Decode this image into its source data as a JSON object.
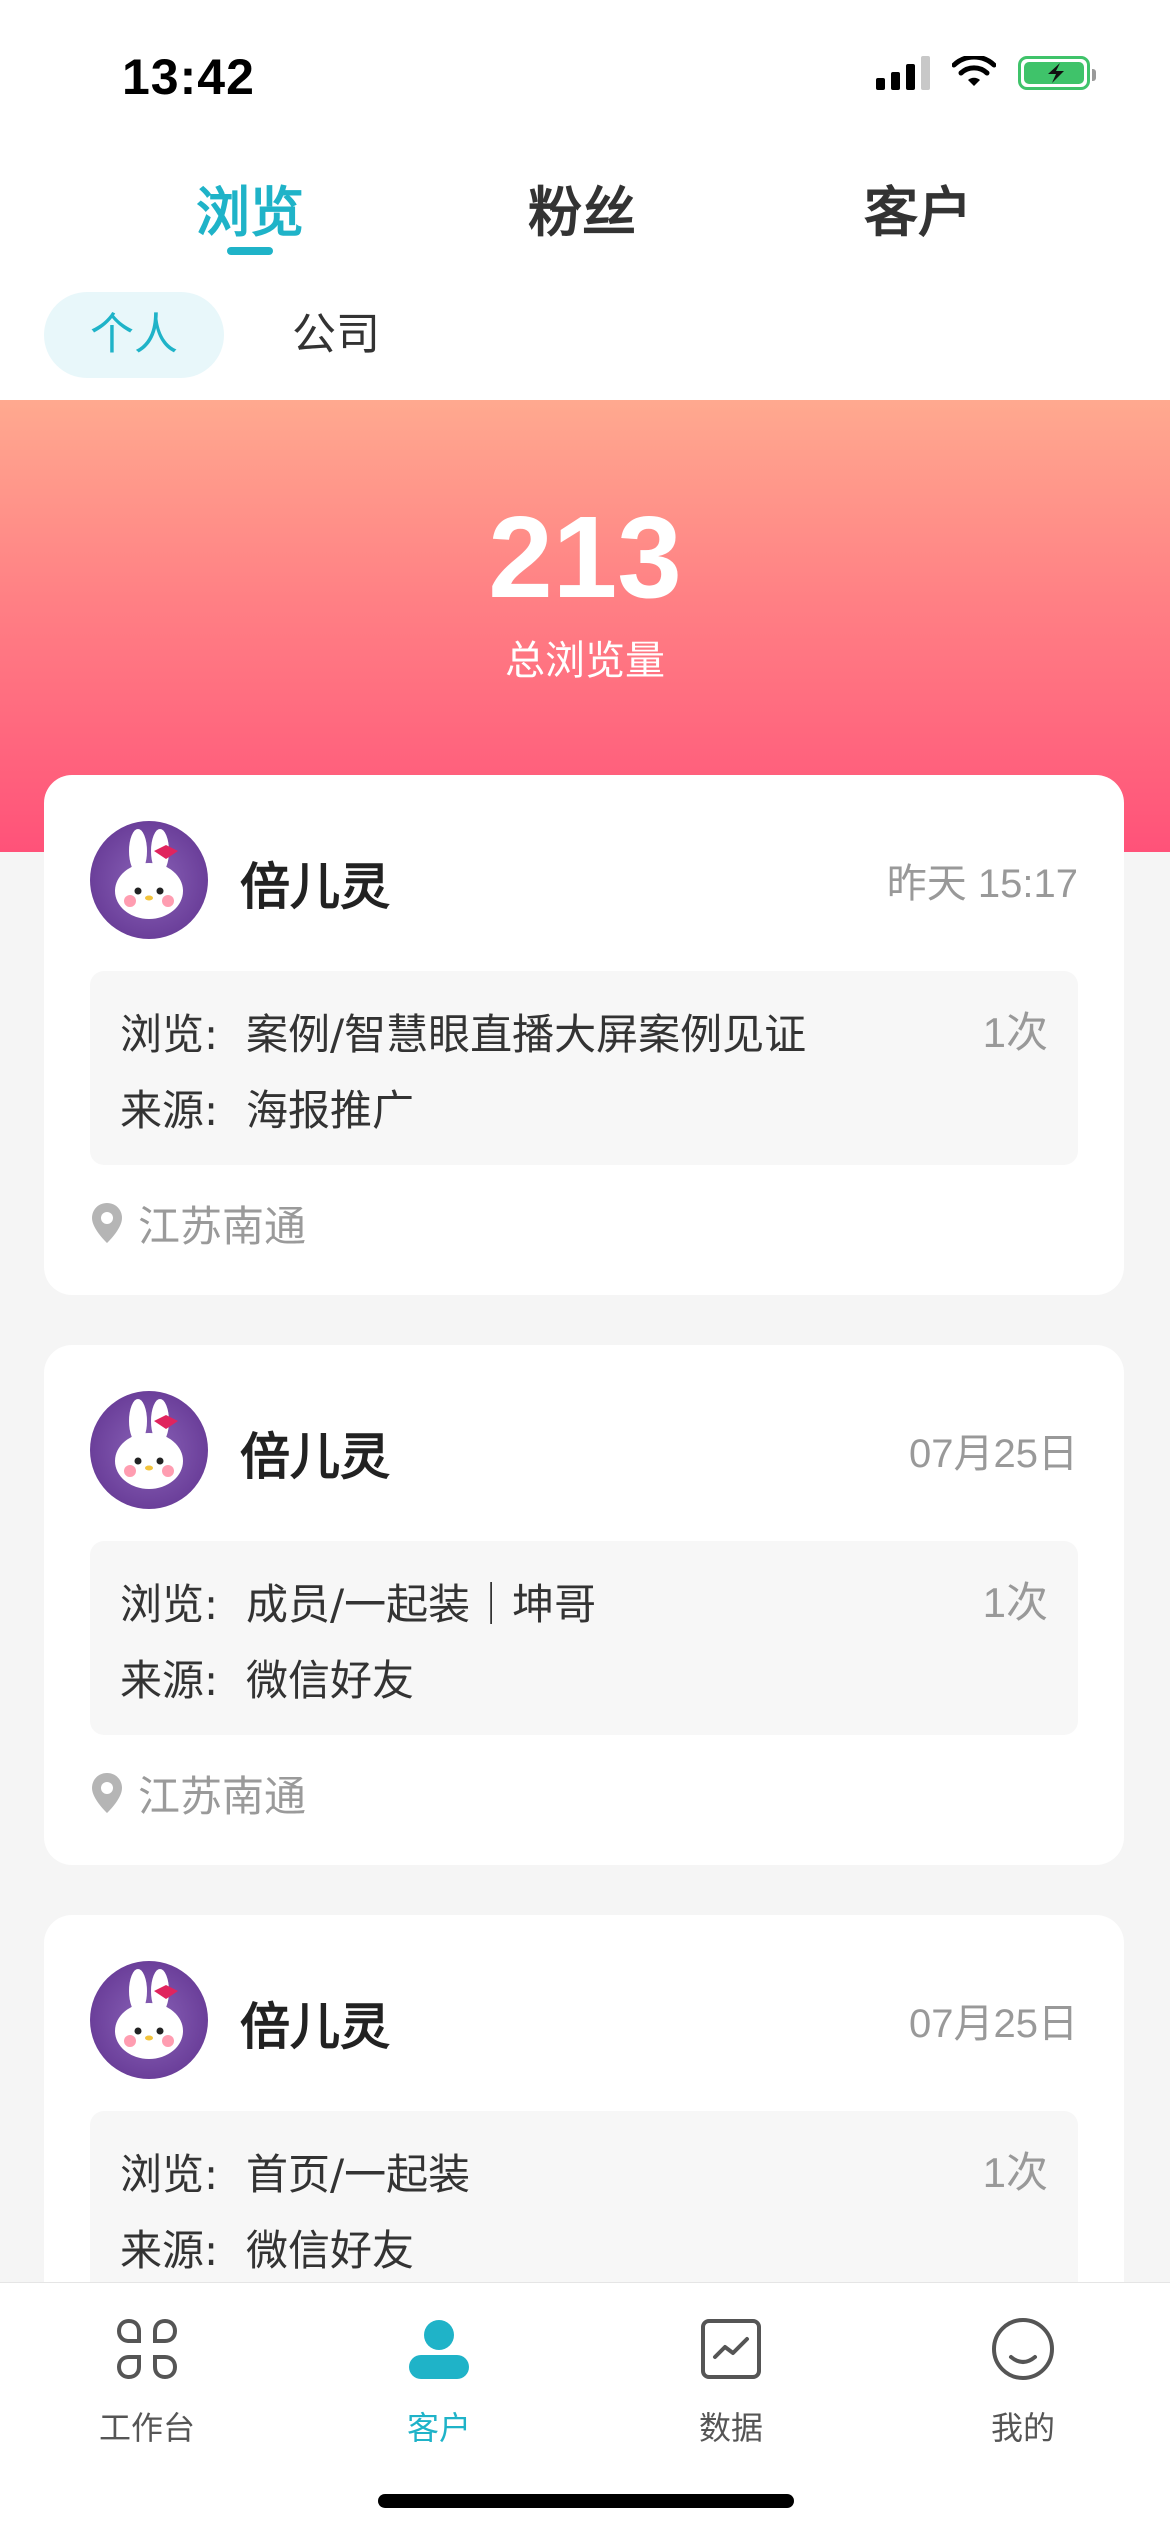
{
  "status_bar": {
    "time": "13:42"
  },
  "top_tabs": [
    {
      "label": "浏览",
      "active": true
    },
    {
      "label": "粉丝",
      "active": false
    },
    {
      "label": "客户",
      "active": false
    }
  ],
  "sub_tabs": [
    {
      "label": "个人",
      "active": true
    },
    {
      "label": "公司",
      "active": false
    }
  ],
  "summary": {
    "total": "213",
    "label": "总浏览量"
  },
  "records": [
    {
      "name": "倍儿灵",
      "time": "昨天 15:17",
      "browse_label": "浏览:",
      "browse_value": "案例/智慧眼直播大屏案例见证",
      "source_label": "来源:",
      "source_value": "海报推广",
      "count": "1次",
      "location": "江苏南通"
    },
    {
      "name": "倍儿灵",
      "time": "07月25日",
      "browse_label": "浏览:",
      "browse_value": "成员/一起装｜坤哥",
      "source_label": "来源:",
      "source_value": "微信好友",
      "count": "1次",
      "location": "江苏南通"
    },
    {
      "name": "倍儿灵",
      "time": "07月25日",
      "browse_label": "浏览:",
      "browse_value": "首页/一起装",
      "source_label": "来源:",
      "source_value": "微信好友",
      "count": "1次"
    }
  ],
  "bottom_nav": [
    {
      "label": "工作台",
      "icon": "grid-icon",
      "active": false
    },
    {
      "label": "客户",
      "icon": "person-icon",
      "active": true
    },
    {
      "label": "数据",
      "icon": "chart-icon",
      "active": false
    },
    {
      "label": "我的",
      "icon": "smile-icon",
      "active": false
    }
  ],
  "colors": {
    "accent": "#1fb3c8",
    "hero_top": "#ffa98f",
    "hero_bottom": "#ff5279"
  }
}
